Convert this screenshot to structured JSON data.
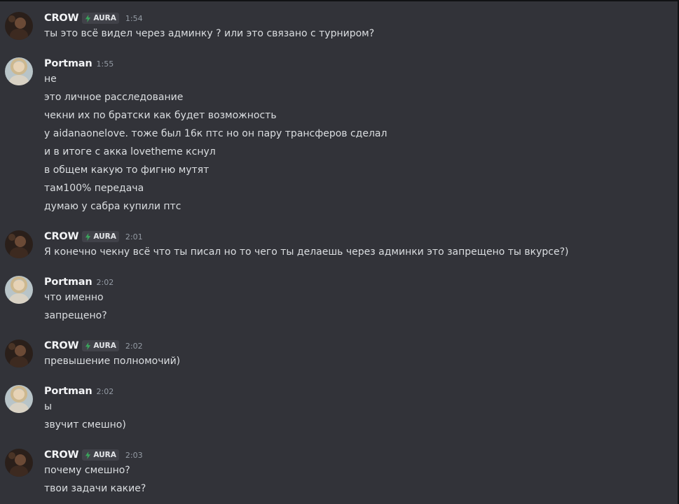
{
  "colors": {
    "background": "#323339",
    "username": "#f2f3f5",
    "message_text": "#dbdee1",
    "timestamp": "#949ba4",
    "tag_background": "#414249",
    "tag_bolt": "#3ba55c"
  },
  "users": {
    "crow": {
      "name": "CROW",
      "tag": "AURA",
      "tag_icon": "lightning-bolt-icon"
    },
    "portman": {
      "name": "Portman"
    }
  },
  "messages": [
    {
      "author": "CROW",
      "time": "1:54",
      "lines": [
        "ты это всё видел через админку ? или это связано с турниром?"
      ]
    },
    {
      "author": "Portman",
      "time": "1:55",
      "lines": [
        "не",
        "это личное расследование",
        "чекни их по братски как будет возможность",
        "у aidanaonelove. тоже был 16к птс но он пару трансферов сделал",
        "и в итоге с акка lovetheme кснул",
        "в общем какую то фигню мутят",
        "там100% передача",
        "думаю у сабра купили птс"
      ]
    },
    {
      "author": "CROW",
      "time": "2:01",
      "lines": [
        "Я конечно чекну всё что ты писал но то чего ты делаешь через админки это запрещено ты вкурсе?)"
      ]
    },
    {
      "author": "Portman",
      "time": "2:02",
      "lines": [
        "что именно",
        "запрещено?"
      ]
    },
    {
      "author": "CROW",
      "time": "2:02",
      "lines": [
        "превышение полномочий)"
      ]
    },
    {
      "author": "Portman",
      "time": "2:02",
      "lines": [
        "ы",
        "звучит смешно)"
      ]
    },
    {
      "author": "CROW",
      "time": "2:03",
      "lines": [
        "почему смешно?",
        "твои задачи какие?"
      ]
    }
  ]
}
